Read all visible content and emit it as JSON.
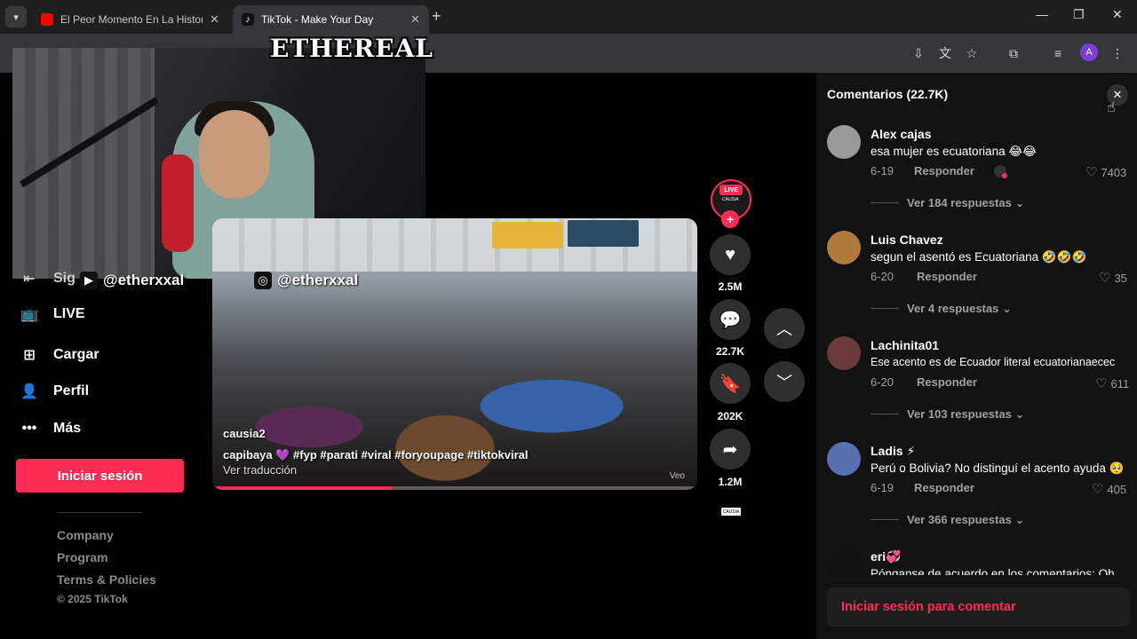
{
  "browser": {
    "tabs": [
      {
        "title": "El Peor Momento En La Historia",
        "active": false,
        "favicon_color": "#ff0000"
      },
      {
        "title": "TikTok - Make Your Day",
        "active": true,
        "favicon_color": "#ffffff"
      }
    ],
    "profile_initial": "A",
    "accent": "#7b3fd6"
  },
  "overlay": {
    "brand": "ETHEREAL",
    "handles": [
      {
        "platform": "tiktok",
        "text": "@etherxxal"
      },
      {
        "platform": "instagram",
        "text": "@etherxxal"
      }
    ]
  },
  "sidebar": {
    "partial_item": "Sig",
    "items": [
      {
        "icon": "live-icon",
        "label": "LIVE"
      },
      {
        "icon": "upload-icon",
        "label": "Cargar"
      },
      {
        "icon": "profile-icon",
        "label": "Perfil"
      },
      {
        "icon": "more-icon",
        "label": "Más"
      }
    ],
    "login_button": "Iniciar sesión",
    "footer_links": [
      "Company",
      "Program",
      "Terms & Policies"
    ],
    "copyright": "© 2025 TikTok"
  },
  "video": {
    "author": "causia2",
    "caption": "capibaya 💜 #fyp #parati #viral #foryoupage #tiktokviral",
    "translate": "Ver traducción",
    "watermark": "Veo",
    "progress": 0.37
  },
  "actions": {
    "live_label": "LIVE",
    "live_user": "CAUSIA",
    "likes": "2.5M",
    "comments": "22.7K",
    "saves": "202K",
    "shares": "1.2M",
    "music_tag": "CAUSIA"
  },
  "comments": {
    "title": "Comentarios (22.7K)",
    "items": [
      {
        "name": "Alex cajas",
        "text": "esa mujer es ecuatoriana 😂😂",
        "date": "6-19",
        "reply": "Responder",
        "likes": "7403",
        "more": "Ver 184 respuestas",
        "avatar": "#9a9a9a"
      },
      {
        "name": "Luis Chavez",
        "text": "segun el asentó es Ecuatoriana 🤣🤣🤣",
        "date": "6-20",
        "reply": "Responder",
        "likes": "35",
        "more": "Ver 4 respuestas",
        "avatar": "#b07a3a"
      },
      {
        "name": "Lachinita01",
        "text": "Ese acento es de Ecuador literal ecuatorianaecec",
        "date": "6-20",
        "reply": "Responder",
        "likes": "611",
        "more": "Ver 103 respuestas",
        "avatar": "#6b3b3b"
      },
      {
        "name": "Ladis ⚡",
        "text": "Perú o Bolivia? No distinguí el acento ayuda 🥺",
        "date": "6-19",
        "reply": "Responder",
        "likes": "405",
        "more": "Ver 366 respuestas",
        "avatar": "#5a6fb0"
      },
      {
        "name": "eri💞",
        "text": "Pónganse de acuerdo en los comentarios: Oh",
        "avatar": "#111111"
      }
    ],
    "login_prompt": "Iniciar sesión para comentar"
  }
}
